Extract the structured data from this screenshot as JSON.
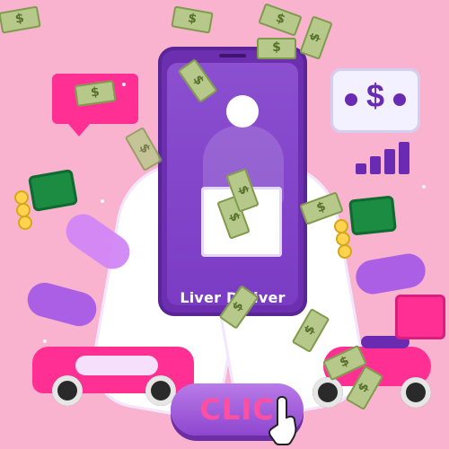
{
  "phone": {
    "brand_text": "Liver Deliver"
  },
  "cta": {
    "label": "CLIC"
  },
  "icons": {
    "dollar_card": "dollar-card-icon",
    "money_bill": "money-bill-icon",
    "money_stack": "money-stack-icon",
    "coin": "coin-icon",
    "speech_bubble": "speech-bubble-icon",
    "car": "car-icon",
    "scooter": "scooter-icon",
    "delivery_box": "delivery-box-icon",
    "cursor_hand": "cursor-hand-icon",
    "chart": "chart-icon"
  },
  "colors": {
    "background": "#f9b3cf",
    "purple": "#6b2fb0",
    "magenta": "#ff2f94",
    "money_green": "#1d8c43"
  }
}
